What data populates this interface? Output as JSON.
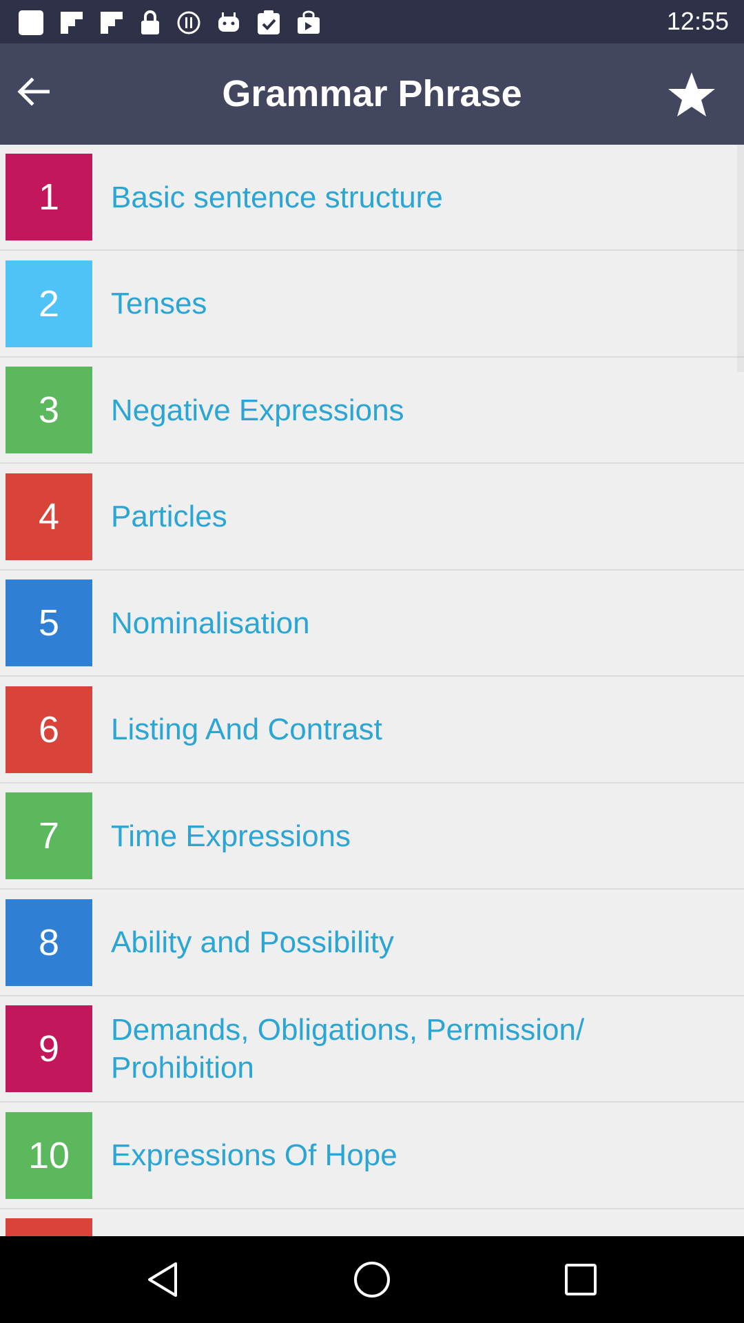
{
  "status_bar": {
    "time": "12:55",
    "left_icons": [
      "notification-square-icon",
      "flipboard-icon",
      "flipboard-icon",
      "lock-icon",
      "pause-circle-icon",
      "android-icon",
      "clipboard-check-icon",
      "shopping-bag-icon"
    ],
    "right_icons": [
      "wifi-icon",
      "signal-icon",
      "battery-icon"
    ]
  },
  "header": {
    "title": "Grammar Phrase",
    "back_icon": "arrow-left-icon",
    "favorite_icon": "star-icon"
  },
  "topics": [
    {
      "number": "1",
      "label": "Basic sentence structure",
      "color": "#c2185b"
    },
    {
      "number": "2",
      "label": "Tenses",
      "color": "#4fc3f7"
    },
    {
      "number": "3",
      "label": "Negative Expressions",
      "color": "#5cb85c"
    },
    {
      "number": "4",
      "label": "Particles",
      "color": "#d9443a"
    },
    {
      "number": "5",
      "label": "Nominalisation",
      "color": "#2f7fd4"
    },
    {
      "number": "6",
      "label": "Listing And Contrast",
      "color": "#d9443a"
    },
    {
      "number": "7",
      "label": "Time Expressions",
      "color": "#5cb85c"
    },
    {
      "number": "8",
      "label": "Ability and Possibility",
      "color": "#2f7fd4"
    },
    {
      "number": "9",
      "label": "Demands, Obligations, Permission/ Prohibition",
      "color": "#c2185b"
    },
    {
      "number": "10",
      "label": "Expressions Of Hope",
      "color": "#5cb85c"
    },
    {
      "number": "",
      "label": "",
      "color": "#d9443a"
    }
  ],
  "nav_bar": {
    "icons": [
      "back-triangle-icon",
      "home-circle-icon",
      "recents-square-icon"
    ]
  }
}
